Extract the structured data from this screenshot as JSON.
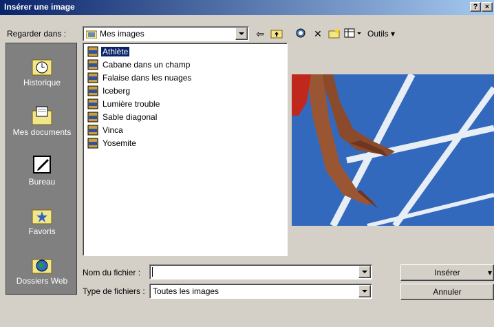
{
  "window": {
    "title": "Insérer une image",
    "help_label": "?",
    "close_label": "×"
  },
  "lookin": {
    "label": "Regarder dans :",
    "value": "Mes images"
  },
  "toolbar": {
    "tools_label": "Outils"
  },
  "places": [
    {
      "label": "Historique",
      "icon": "history-icon"
    },
    {
      "label": "Mes documents",
      "icon": "my-documents-icon"
    },
    {
      "label": "Bureau",
      "icon": "desktop-icon"
    },
    {
      "label": "Favoris",
      "icon": "favorites-icon"
    },
    {
      "label": "Dossiers Web",
      "icon": "web-folders-icon"
    }
  ],
  "files": [
    {
      "name": "Athlète",
      "selected": true
    },
    {
      "name": "Cabane dans un champ",
      "selected": false
    },
    {
      "name": "Falaise dans les nuages",
      "selected": false
    },
    {
      "name": "Iceberg",
      "selected": false
    },
    {
      "name": "Lumière trouble",
      "selected": false
    },
    {
      "name": "Sable diagonal",
      "selected": false
    },
    {
      "name": "Vinca",
      "selected": false
    },
    {
      "name": "Yosemite",
      "selected": false
    }
  ],
  "filename": {
    "label": "Nom du fichier :",
    "value": ""
  },
  "filetype": {
    "label": "Type de fichiers :",
    "value": "Toutes les images"
  },
  "buttons": {
    "insert": "Insérer",
    "cancel": "Annuler"
  },
  "colors": {
    "title_bar": "#0a246a",
    "selection": "#0a246a",
    "face": "#d4d0c8",
    "places_bg": "#808080"
  }
}
